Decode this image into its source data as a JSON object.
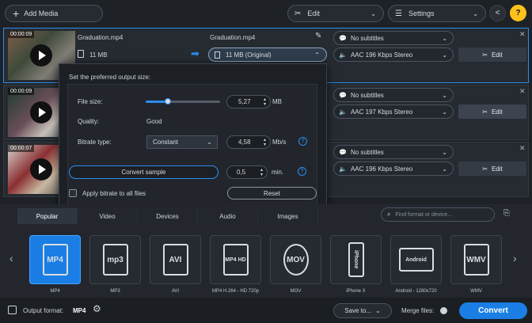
{
  "toolbar": {
    "add_media": "Add Media",
    "edit": "Edit",
    "settings": "Settings"
  },
  "files": [
    {
      "duration": "00:00:09",
      "name": "Graduation.mp4",
      "out_name": "Graduation.mp4",
      "size": "11 MB",
      "out_size": "11 MB (Original)",
      "subtitles": "No subtitles",
      "audio": "AAC 196 Kbps Stereo",
      "edit_label": "Edit"
    },
    {
      "duration": "00:00:09",
      "subtitles": "No subtitles",
      "audio": "AAC 197 Kbps Stereo",
      "edit_label": "Edit"
    },
    {
      "duration": "00:00:07",
      "subtitles": "No subtitles",
      "audio": "AAC 196 Kbps Stereo",
      "edit_label": "Edit"
    }
  ],
  "popup": {
    "title": "Set the preferred output size:",
    "file_size_label": "File size:",
    "file_size_value": "5,27",
    "file_size_unit": "MB",
    "file_size_slider_fraction": 0.3,
    "quality_label": "Quality:",
    "quality_value": "Good",
    "bitrate_type_label": "Bitrate type:",
    "bitrate_type_value": "Constant",
    "bitrate_value": "4,58",
    "bitrate_unit": "Mb/s",
    "convert_sample": "Convert sample",
    "sample_value": "0,5",
    "sample_unit": "min.",
    "apply_label": "Apply bitrate to all files",
    "reset": "Reset"
  },
  "tabs": [
    "Popular",
    "Video",
    "Devices",
    "Audio",
    "Images"
  ],
  "search_placeholder": "Find format or device...",
  "formats": [
    {
      "icon": "MP4",
      "label": "MP4"
    },
    {
      "icon": "mp3",
      "label": "MP3"
    },
    {
      "icon": "AVI",
      "label": "AVI"
    },
    {
      "icon": "MP4 HD",
      "label": "MP4 H.264 - HD 720p"
    },
    {
      "icon": "MOV",
      "label": "MOV"
    },
    {
      "icon": "iPhone",
      "label": "iPhone X"
    },
    {
      "icon": "Android",
      "label": "Android - 1280x720"
    },
    {
      "icon": "WMV",
      "label": "WMV"
    }
  ],
  "bottom": {
    "output_format_label": "Output format:",
    "output_format_value": "MP4",
    "save_to": "Save to...",
    "merge_files": "Merge files:",
    "convert": "Convert"
  },
  "colors": {
    "accent": "#1a7ee5",
    "background": "#1e2227"
  }
}
